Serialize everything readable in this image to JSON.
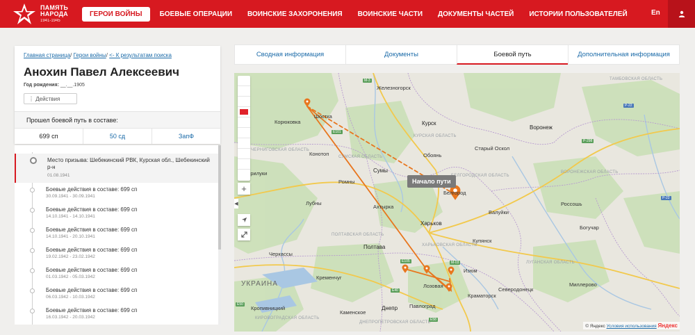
{
  "header": {
    "logo_line1": "ПАМЯТЬ",
    "logo_line2": "НАРОДА",
    "logo_years": "1941-1945",
    "nav": [
      "Герои войны",
      "Боевые операции",
      "Воинские захоронения",
      "Воинские части",
      "Документы частей",
      "Истории пользователей"
    ],
    "lang": "En",
    "colors": {
      "brand": "#d71920"
    }
  },
  "person": {
    "breadcrumb": {
      "home": "Главная страница",
      "heroes": "Герои войны",
      "back": "<- К результатам поиска"
    },
    "name": "Анохин Павел Алексеевич",
    "birth_label": "Год рождения:",
    "birth_value": "__.__.1905",
    "actions_label": "⋮ Действия",
    "units_heading": "Прошел боевой путь в составе:",
    "unit_tabs": [
      "699 сп",
      "50 сд",
      "ЗапФ"
    ]
  },
  "timeline": [
    {
      "title": "Место призыва: Шебекинский РВК, Курская обл., Шебекинский р-н",
      "date": "01.08.1941"
    },
    {
      "title": "Боевые действия в составе: 699 сп",
      "date": "30.09.1941 - 30.09.1941"
    },
    {
      "title": "Боевые действия в составе: 699 сп",
      "date": "14.10.1941 - 14.10.1941"
    },
    {
      "title": "Боевые действия в составе: 699 сп",
      "date": "14.10.1941 - 20.10.1941"
    },
    {
      "title": "Боевые действия в составе: 699 сп",
      "date": "19.02.1942 - 23.02.1942"
    },
    {
      "title": "Боевые действия в составе: 699 сп",
      "date": "01.03.1942 - 05.03.1942"
    },
    {
      "title": "Боевые действия в составе: 699 сп",
      "date": "06.03.1942 - 10.03.1942"
    },
    {
      "title": "Боевые действия в составе: 699 сп",
      "date": "16.03.1942 - 20.03.1942"
    }
  ],
  "right_tabs": [
    "Сводная информация",
    "Документы",
    "Боевой путь",
    "Дополнительная информация"
  ],
  "map": {
    "tooltip": "Начало пути",
    "labels": {
      "zheleznogorsk": "Железногорск",
      "kursk": "Курск",
      "voronezh": "Воронеж",
      "shostka": "Шостка",
      "koryukovka": "Корюковка",
      "konotop": "Конотоп",
      "sumy": "Сумы",
      "oboyan": "Обоянь",
      "stary_oskol": "Старый Оскол",
      "belgorod": "Белгород",
      "kharkov": "Харьков",
      "akhtyrka": "Ахтырка",
      "lubny": "Лубны",
      "poltava": "Полтава",
      "cherkassy": "Черкассы",
      "kremenchug": "Кременчуг",
      "dnepr": "Днепр",
      "pavlograd": "Павлоград",
      "izyum": "Изюм",
      "kramatorsk": "Краматорск",
      "severodonetsk": "Северодонецк",
      "kupyansk": "Купянск",
      "valuyki": "Валуйки",
      "rossosh": "Россошь",
      "boguchar": "Богучар",
      "millerovo": "Миллерово",
      "kropyvnytskyi": "Кропивницкий",
      "kamenskoe": "Каменское",
      "pryluky": "Прилуки",
      "lozovaya": "Лозовая",
      "ukraine": "УКРАИНА",
      "romny": "Ромны",
      "tambov_obl": "ТАМБОВСКАЯ ОБЛАСТЬ",
      "voronezh_obl": "ВОРОНЕЖСКАЯ ОБЛАСТЬ",
      "chernigov_obl": "ЧЕРНИГОВСКАЯ ОБЛАСТЬ",
      "sumy_obl": "СУМСКАЯ ОБЛАСТЬ",
      "belgorod_obl": "БЕЛГОРОДСКАЯ ОБЛАСТЬ",
      "kursk_obl": "КУРСКАЯ ОБЛАСТЬ",
      "poltava_obl": "ПОЛТАВСКАЯ ОБЛАСТЬ",
      "kharkov_obl": "ХАРЬКОВСКАЯ ОБЛАСТЬ",
      "lugansk_obl": "ЛУГАНСКАЯ ОБЛАСТЬ",
      "kirovograd_obl": "КИРОВОГРАДСКАЯ ОБЛАСТЬ",
      "dnepr_obl": "ДНЕПРОПЕТРОВСКАЯ ОБЛАСТЬ"
    },
    "roads": [
      "М-3",
      "Р-22",
      "Р-298",
      "E101",
      "Е105",
      "E40",
      "М-03",
      "E50",
      "E58",
      "Р-22"
    ],
    "copyright": "© Яндекс",
    "terms": "Условия использования",
    "yandex": "Яндекс",
    "route_color": "#e8761e"
  }
}
